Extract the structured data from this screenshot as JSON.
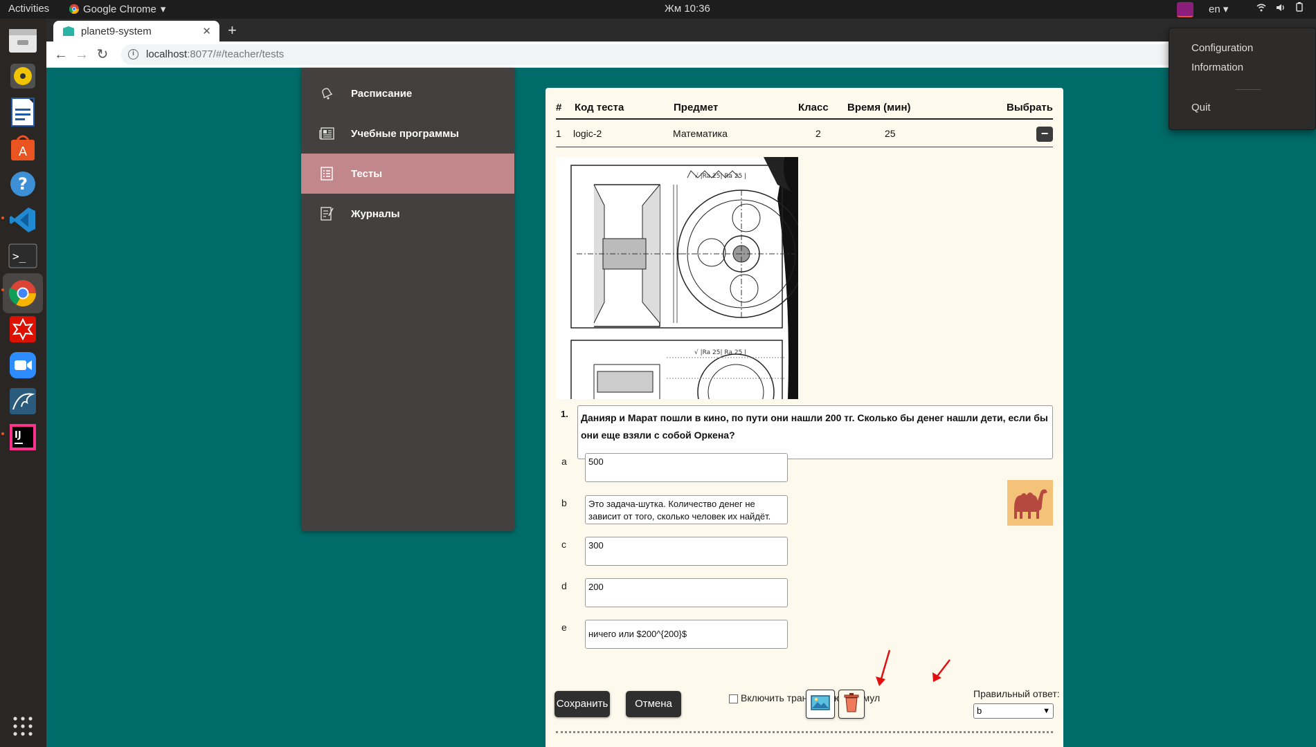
{
  "topbar": {
    "activities": "Activities",
    "app_name": "Google Chrome",
    "clock": "Жм 10:36",
    "lang": "en"
  },
  "chrome": {
    "tab_title": "planet9-system",
    "url_host": "localhost",
    "url_rest": ":8077/#/teacher/tests"
  },
  "sidebar": {
    "items": [
      {
        "label": "Расписание",
        "icon": "bell-icon"
      },
      {
        "label": "Учебные программы",
        "icon": "newspaper-icon"
      },
      {
        "label": "Тесты",
        "icon": "checklist-icon",
        "active": true
      },
      {
        "label": "Журналы",
        "icon": "journal-icon"
      }
    ]
  },
  "table": {
    "headers": [
      "#",
      "Код теста",
      "Предмет",
      "Класс",
      "Время (мин)",
      "Выбрать"
    ],
    "row": {
      "num": "1",
      "code": "logic-2",
      "subject": "Математика",
      "grade": "2",
      "time": "25"
    }
  },
  "question": {
    "number": "1.",
    "text": "Данияр и Марат пошли в кино, по пути они нашли 200 тг. Сколько бы денег нашли дети, если бы они еще взяли с собой Оркена?"
  },
  "answers": [
    {
      "letter": "a",
      "text": "500"
    },
    {
      "letter": "b",
      "text": "Это задача-шутка. Количество денег не зависит от того, сколько человек их найдёт."
    },
    {
      "letter": "c",
      "text": "300"
    },
    {
      "letter": "d",
      "text": "200"
    },
    {
      "letter": "e",
      "text": "ничего или $200^{200}$"
    }
  ],
  "footer": {
    "save_label": "Сохранить",
    "cancel_label": "Отмена",
    "formula_label": "Включить трансляцию формул",
    "correct_answer_label": "Правильный ответ:",
    "correct_answer_value": "b"
  },
  "popover": {
    "items": [
      "Configuration",
      "Information",
      "Quit"
    ]
  },
  "colors": {
    "page_bg": "#006b68",
    "sidebar_bg": "#44403f",
    "sidebar_active": "#c2878a",
    "panel_bg": "#fdf9ec"
  }
}
